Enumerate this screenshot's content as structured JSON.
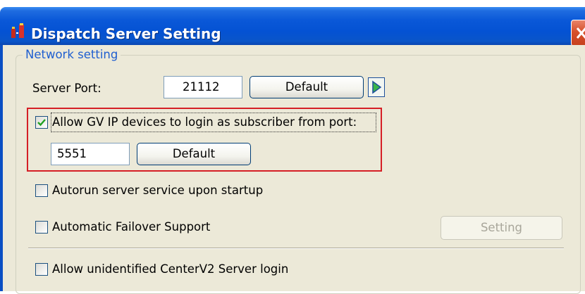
{
  "window": {
    "title": "Dispatch Server Setting"
  },
  "network_group": {
    "title": "Network setting",
    "server_port": {
      "label": "Server Port:",
      "value": "21112",
      "default_button": "Default"
    },
    "allow_gv_ip": {
      "checked": true,
      "label": "Allow GV IP devices to login as subscriber from port:",
      "port_value": "5551",
      "default_button": "Default"
    },
    "autorun": {
      "checked": false,
      "label": "Autorun server service upon startup"
    },
    "failover": {
      "checked": false,
      "label": "Automatic Failover Support",
      "setting_button": "Setting",
      "setting_enabled": false
    },
    "allow_unidentified": {
      "checked": false,
      "label": "Allow unidentified CenterV2 Server login"
    }
  },
  "colors": {
    "titlebar": "#0452d3",
    "client_bg": "#ece9d8",
    "group_title": "#1f5fd0",
    "highlight_box": "#d51f26",
    "close_button": "#d6502b"
  }
}
